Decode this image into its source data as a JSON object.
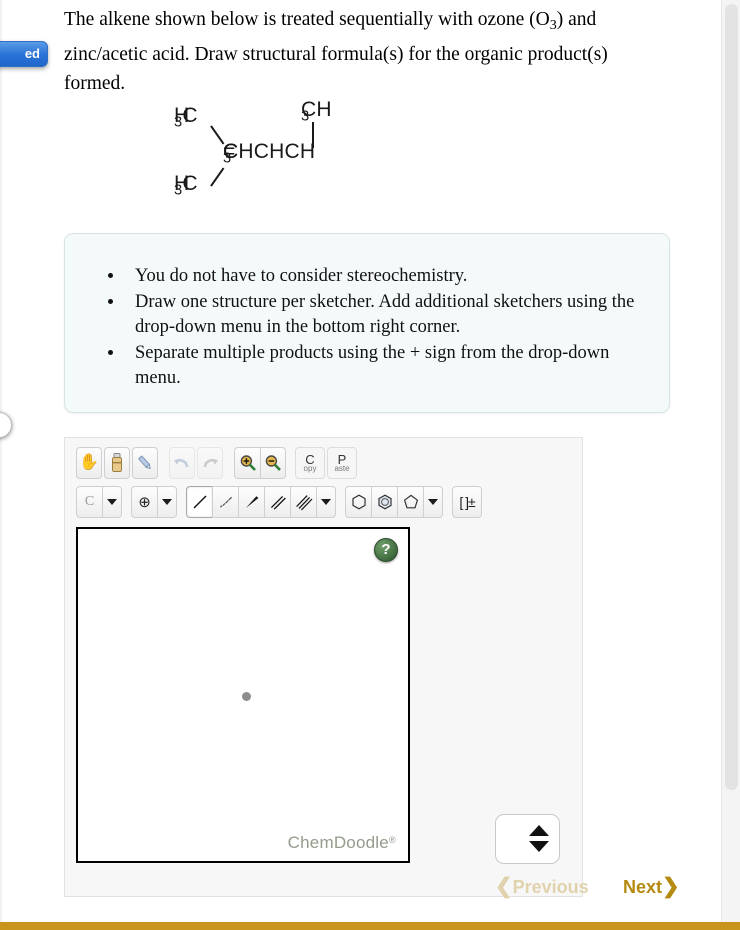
{
  "feedback_tab": {
    "label": "ed"
  },
  "question": {
    "line1_a": "The alkene shown below is treated sequentially with ozone (O",
    "line1_sub": "3",
    "line1_b": ") and",
    "line2": "zinc/acetic acid. Draw structural formula(s) for the organic product(s)",
    "line3": "formed."
  },
  "structure": {
    "name": "2,4-dimethyl-2-pentene",
    "top_left": "H",
    "top_left_sub": "3",
    "top_left_rest": "C",
    "top_methyl": "CH",
    "top_methyl_sub": "3",
    "main_chain_a": "C",
    "main_chain_bond": "=",
    "main_chain_b": "CHCHCH",
    "main_chain_sub": "3",
    "bottom_left": "H",
    "bottom_left_sub": "3",
    "bottom_left_rest": "C"
  },
  "hints": {
    "items": [
      "You do not have to consider stereochemistry.",
      "Draw one structure per sketcher. Add additional sketchers using the drop-down menu in the bottom right corner.",
      "Separate multiple products using the + sign from the drop-down menu."
    ]
  },
  "sketcher": {
    "toolbar_row1": [
      {
        "name": "pan-hand-icon",
        "title": "Move / pan",
        "glyph": "✋"
      },
      {
        "name": "clear-icon",
        "title": "Clear",
        "glyph": "🧴"
      },
      {
        "name": "pencil-icon",
        "title": "Draw",
        "glyph": "✎"
      },
      {
        "name": "undo-icon",
        "title": "Undo",
        "glyph": "↶"
      },
      {
        "name": "redo-icon",
        "title": "Redo",
        "glyph": "↷"
      },
      {
        "name": "zoom-in-icon",
        "title": "Zoom in",
        "glyph": "🔍"
      },
      {
        "name": "zoom-out-icon",
        "title": "Zoom out",
        "glyph": "🔍"
      }
    ],
    "copy_button": {
      "big": "C",
      "small": "opy"
    },
    "paste_button": {
      "big": "P",
      "small": "aste"
    },
    "element_button": {
      "label": "C",
      "title": "Carbon"
    },
    "charge_button": {
      "label": "⊕",
      "title": "Charge"
    },
    "bond_tools": [
      {
        "name": "single-bond-icon",
        "title": "Single bond",
        "selected": true
      },
      {
        "name": "hash-bond-icon",
        "title": "Hashed bond",
        "selected": false
      },
      {
        "name": "wedge-bond-icon",
        "title": "Wedge bond",
        "selected": false
      },
      {
        "name": "double-bond-icon",
        "title": "Double bond",
        "selected": false
      },
      {
        "name": "triple-bond-icon",
        "title": "Triple bond",
        "selected": false
      }
    ],
    "ring_tools": [
      {
        "name": "cyclohexane-ring-icon",
        "title": "Cyclohexane"
      },
      {
        "name": "benzene-ring-icon",
        "title": "Benzene"
      },
      {
        "name": "cyclopentane-ring-icon",
        "title": "Cyclopentane"
      }
    ],
    "bracket_button": {
      "label": "[ ]±",
      "title": "Brackets / charge"
    },
    "help_badge": {
      "label": "?"
    },
    "watermark": {
      "text": "ChemDoodle",
      "mark": "®"
    }
  },
  "spinner": {
    "up": "▲",
    "down": "▼"
  },
  "nav": {
    "previous": {
      "label": "Previous",
      "chevron": "❮",
      "disabled": true,
      "color": "#e0d2ac"
    },
    "next": {
      "label": "Next",
      "chevron": "❯",
      "disabled": false,
      "color": "#b58a10"
    }
  },
  "colors": {
    "accent_gold": "#c8941b",
    "hint_box_bg": "#f4fafa",
    "feedback_blue": "#2a73d6",
    "watermark_green": "#939c8c"
  }
}
